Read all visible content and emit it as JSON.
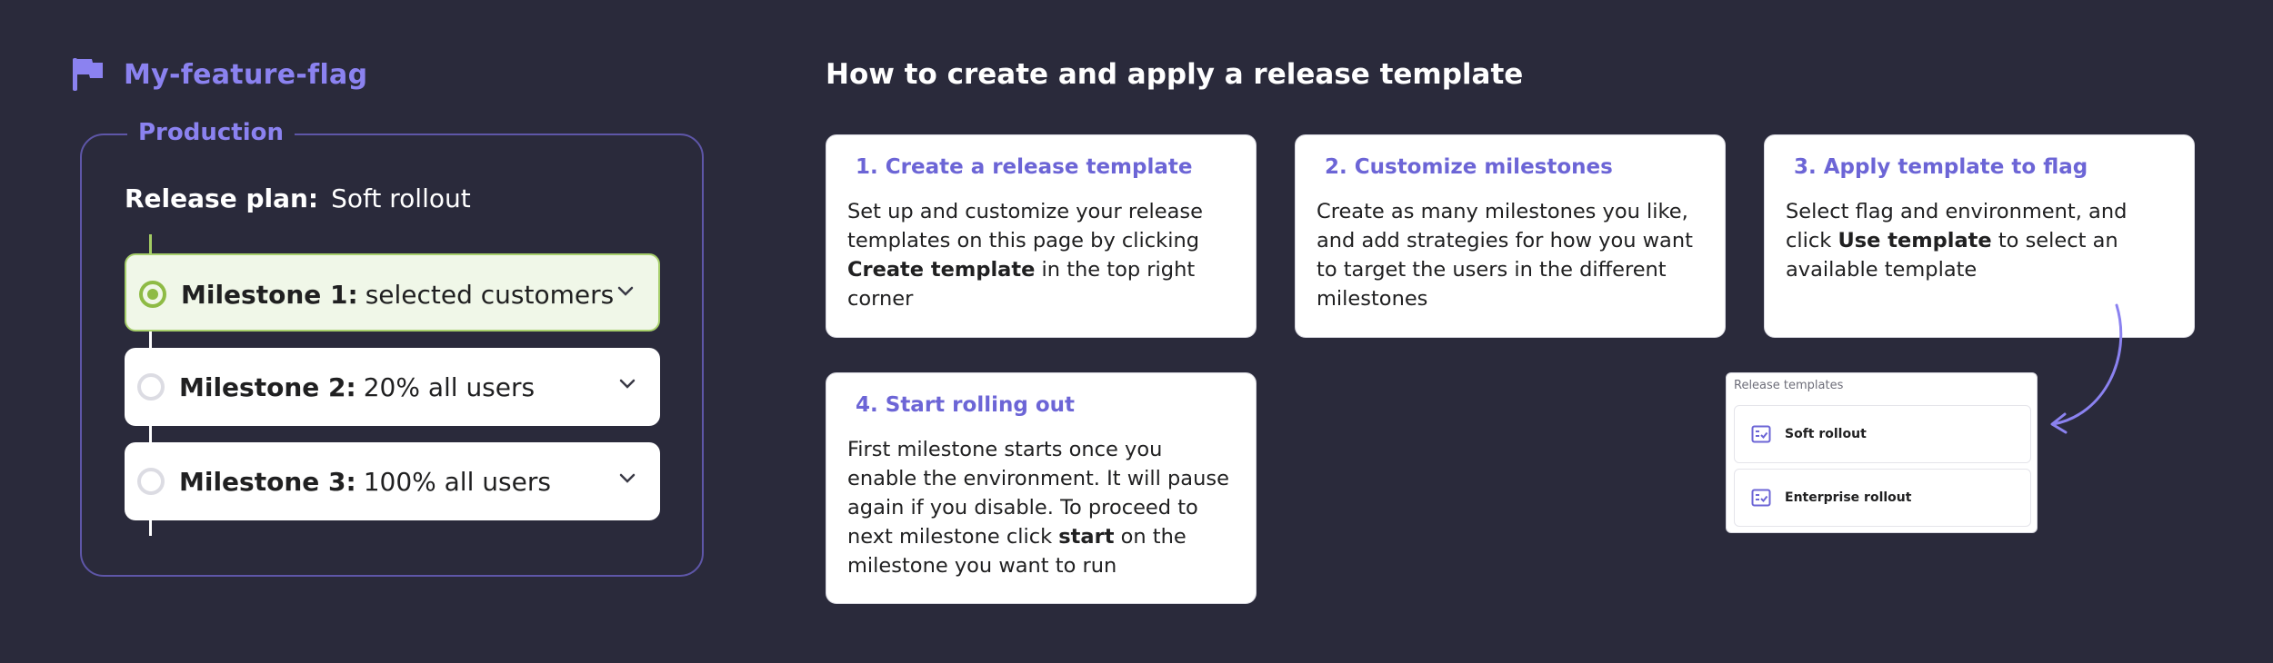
{
  "flag": {
    "name": "My-feature-flag",
    "icon": "flag-icon"
  },
  "environment": {
    "name": "Production",
    "release_plan_label": "Release plan:",
    "release_plan_value": "Soft rollout",
    "milestones": [
      {
        "name": "Milestone 1:",
        "description": "selected customers",
        "active": true
      },
      {
        "name": "Milestone 2:",
        "description": "20% all users",
        "active": false
      },
      {
        "name": "Milestone 3:",
        "description": "100% all users",
        "active": false
      }
    ]
  },
  "guide": {
    "title": "How to create and apply a release template",
    "steps": [
      {
        "title": "1. Create a release template",
        "body_pre": "Set up and customize your release templates on this page by clicking ",
        "body_bold": "Create template",
        "body_post": " in the top right corner"
      },
      {
        "title": "2. Customize milestones",
        "body_pre": "Create as many milestones you like, and add strategies for how you want to target the users in the different milestones",
        "body_bold": "",
        "body_post": ""
      },
      {
        "title": "3. Apply template to flag",
        "body_pre": "Select flag and environment, and click ",
        "body_bold": "Use template",
        "body_post": " to select an available template"
      },
      {
        "title": "4. Start rolling out",
        "body_pre": "First milestone starts once you enable the environment. It will pause again if you disable. To proceed to next milestone click ",
        "body_bold": "start",
        "body_post": " on the milestone you want to run"
      }
    ]
  },
  "release_templates_panel": {
    "title": "Release templates",
    "items": [
      "Soft rollout",
      "Enterprise rollout"
    ]
  },
  "colors": {
    "background": "#2a2a3b",
    "accent": "#8b82f0",
    "card_title": "#6c65d6",
    "active_milestone_bg": "#f0f7e8",
    "active_milestone_border": "#a7cf6b"
  }
}
